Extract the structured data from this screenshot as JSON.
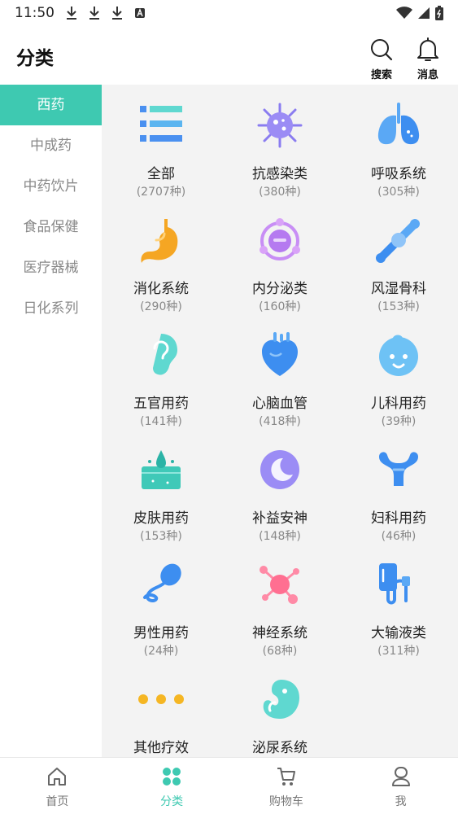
{
  "status_bar": {
    "time": "11:50"
  },
  "header": {
    "title": "分类",
    "search_label": "搜索",
    "message_label": "消息"
  },
  "sidebar": {
    "items": [
      {
        "label": "西药",
        "active": true
      },
      {
        "label": "中成药"
      },
      {
        "label": "中药饮片"
      },
      {
        "label": "食品保健"
      },
      {
        "label": "医疗器械"
      },
      {
        "label": "日化系列"
      }
    ]
  },
  "categories": [
    {
      "name": "全部",
      "count": "(2707种)",
      "icon": "list-icon"
    },
    {
      "name": "抗感染类",
      "count": "(380种)",
      "icon": "virus-icon"
    },
    {
      "name": "呼吸系统",
      "count": "(305种)",
      "icon": "lungs-icon"
    },
    {
      "name": "消化系统",
      "count": "(290种)",
      "icon": "stomach-icon"
    },
    {
      "name": "内分泌类",
      "count": "(160种)",
      "icon": "endocrine-icon"
    },
    {
      "name": "风湿骨科",
      "count": "(153种)",
      "icon": "bone-joint-icon"
    },
    {
      "name": "五官用药",
      "count": "(141种)",
      "icon": "ear-icon"
    },
    {
      "name": "心脑血管",
      "count": "(418种)",
      "icon": "heart-icon"
    },
    {
      "name": "儿科用药",
      "count": "(39种)",
      "icon": "baby-face-icon"
    },
    {
      "name": "皮肤用药",
      "count": "(153种)",
      "icon": "skin-icon"
    },
    {
      "name": "补益安神",
      "count": "(148种)",
      "icon": "moon-icon"
    },
    {
      "name": "妇科用药",
      "count": "(46种)",
      "icon": "uterus-icon"
    },
    {
      "name": "男性用药",
      "count": "(24种)",
      "icon": "sperm-icon"
    },
    {
      "name": "神经系统",
      "count": "(68种)",
      "icon": "neuron-icon"
    },
    {
      "name": "大输液类",
      "count": "(311种)",
      "icon": "iv-drip-icon"
    },
    {
      "name": "其他疗效",
      "count": "",
      "icon": "more-dots-icon"
    },
    {
      "name": "泌尿系统",
      "count": "",
      "icon": "kidney-icon"
    }
  ],
  "tabbar": {
    "items": [
      {
        "label": "首页",
        "icon": "home-icon"
      },
      {
        "label": "分类",
        "icon": "category-icon",
        "active": true
      },
      {
        "label": "购物车",
        "icon": "cart-icon"
      },
      {
        "label": "我",
        "icon": "user-icon"
      }
    ]
  },
  "colors": {
    "accent": "#3ec9b1",
    "content_bg": "#f3f3f3",
    "icon_blue": "#4a90f0",
    "icon_orange": "#f5a623",
    "icon_purple": "#9b7cf0",
    "icon_pink": "#ff6f91"
  }
}
